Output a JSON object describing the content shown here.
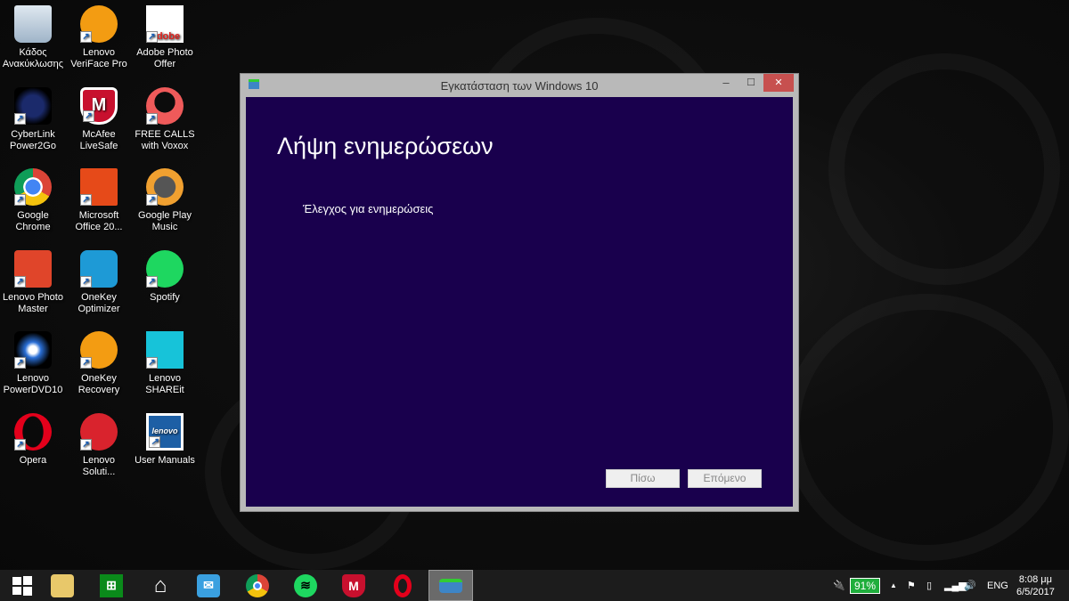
{
  "desktop_icons": [
    {
      "label": "Κάδος Ανακύκλωσης",
      "icon": "recycle-bin-icon"
    },
    {
      "label": "Lenovo VeriFace Pro",
      "icon": "veriface-icon"
    },
    {
      "label": "Adobe Photo Offer",
      "icon": "adobe-icon",
      "glyph": "Adobe"
    },
    {
      "label": "CyberLink Power2Go",
      "icon": "power2go-icon"
    },
    {
      "label": "McAfee LiveSafe",
      "icon": "mcafee-icon",
      "glyph": "M"
    },
    {
      "label": "FREE CALLS with Voxox",
      "icon": "voxox-icon"
    },
    {
      "label": "Google Chrome",
      "icon": "chrome-icon"
    },
    {
      "label": "Microsoft Office 20...",
      "icon": "office-icon"
    },
    {
      "label": "Google Play Music",
      "icon": "play-music-icon"
    },
    {
      "label": "Lenovo Photo Master",
      "icon": "photo-master-icon"
    },
    {
      "label": "OneKey Optimizer",
      "icon": "onekey-optimizer-icon"
    },
    {
      "label": "Spotify",
      "icon": "spotify-icon"
    },
    {
      "label": "Lenovo PowerDVD10",
      "icon": "powerdvd-icon"
    },
    {
      "label": "OneKey Recovery",
      "icon": "onekey-recovery-icon"
    },
    {
      "label": "Lenovo SHAREit",
      "icon": "shareit-icon"
    },
    {
      "label": "Opera",
      "icon": "opera-icon"
    },
    {
      "label": "Lenovo Soluti...",
      "icon": "lenovo-solutions-icon"
    },
    {
      "label": "User Manuals",
      "icon": "user-manuals-icon",
      "glyph": "lenovo"
    }
  ],
  "window": {
    "title": "Εγκατάσταση των Windows 10",
    "heading": "Λήψη ενημερώσεων",
    "status": "Έλεγχος για ενημερώσεις",
    "back_label": "Πίσω",
    "next_label": "Επόμενο",
    "minimize": "‒",
    "maximize": "☐",
    "close": "✕"
  },
  "taskbar": {
    "apps": [
      "start",
      "file-explorer",
      "store",
      "home",
      "mail",
      "chrome",
      "spotify",
      "mcafee",
      "opera",
      "windows10-setup"
    ],
    "battery": "91%",
    "language": "ENG",
    "time": "8:08 μμ",
    "date": "6/5/2017"
  }
}
